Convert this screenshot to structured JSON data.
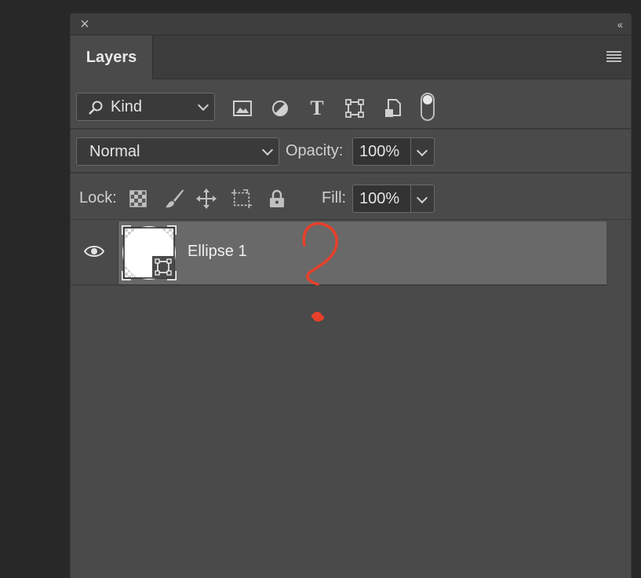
{
  "panel": {
    "close_icon": "close-icon",
    "collapse_icon": "double-chevron-left-icon",
    "collapse_label": "‹‹",
    "tab_label": "Layers",
    "menu_icon": "panel-menu-icon"
  },
  "filter": {
    "kind_label": "Kind",
    "icons": [
      "image-filter-icon",
      "adjustment-filter-icon",
      "type-filter-icon",
      "shape-filter-icon",
      "smart-object-filter-icon"
    ],
    "type_glyph": "T"
  },
  "blend": {
    "mode": "Normal",
    "opacity_label": "Opacity:",
    "opacity_value": "100%"
  },
  "lock": {
    "label": "Lock:",
    "icons": [
      "lock-transparent-pixels-icon",
      "lock-image-pixels-icon",
      "lock-position-icon",
      "lock-artboard-icon",
      "lock-all-icon"
    ],
    "fill_label": "Fill:",
    "fill_value": "100%"
  },
  "layers": [
    {
      "name": "Ellipse 1",
      "visible": true,
      "type": "shape"
    }
  ],
  "colors": {
    "panel_bg": "#4a4a4a",
    "selected_row": "#696969",
    "annotation_red": "#e8402a"
  }
}
